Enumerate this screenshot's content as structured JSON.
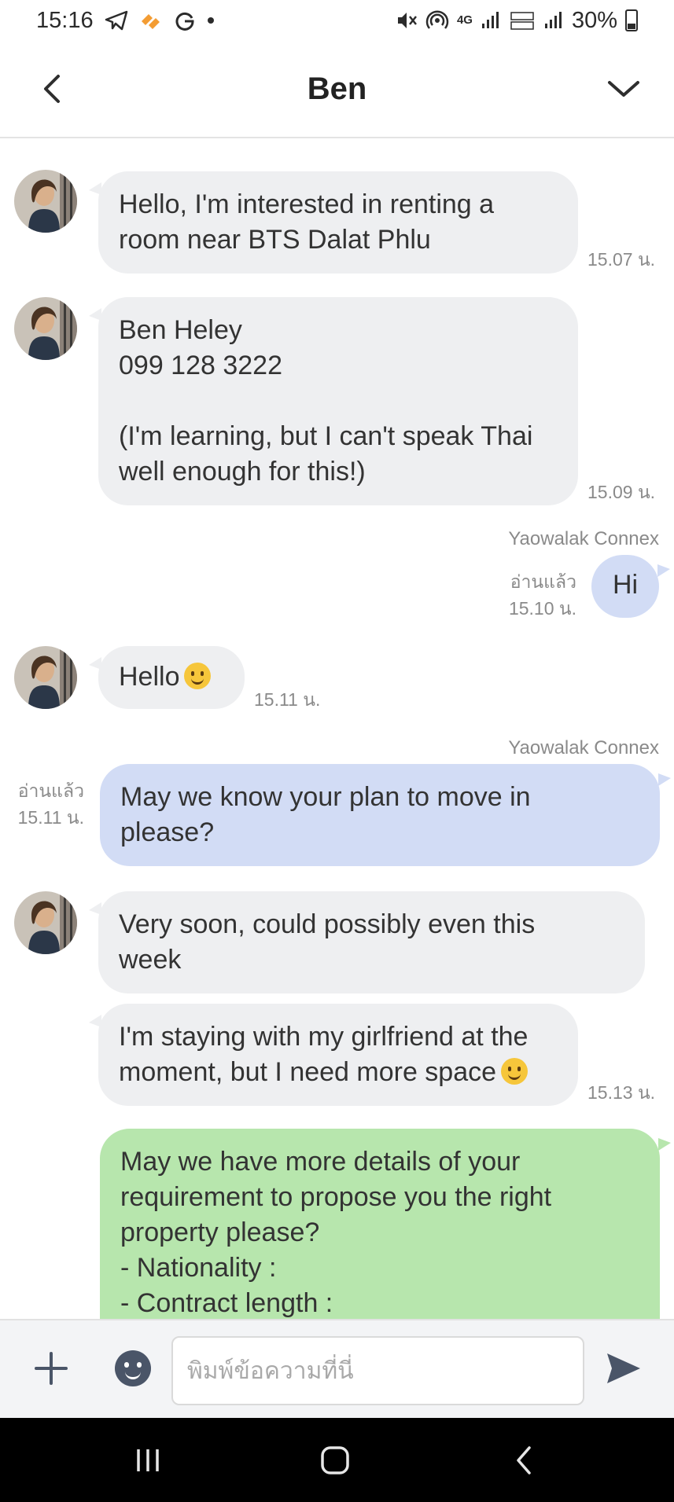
{
  "status_bar": {
    "time": "15:16",
    "battery": "30%",
    "network": "4G"
  },
  "header": {
    "title": "Ben"
  },
  "messages": {
    "m1": {
      "lines": [
        "Hello, I'm interested in renting a",
        "room near BTS Dalat Phlu"
      ],
      "time": "15.07 น."
    },
    "m2": {
      "lines": [
        "Ben Heley",
        "099 128 3222",
        "",
        "(I'm learning, but I can't speak Thai",
        "well enough for this!)"
      ],
      "time": "15.09 น."
    },
    "m3": {
      "sender": "Yaowalak Connex",
      "text": "Hi",
      "read": "อ่านแล้ว",
      "time": "15.10 น."
    },
    "m4": {
      "text": "Hello",
      "time": "15.11 น."
    },
    "m5": {
      "sender": "Yaowalak Connex",
      "lines": [
        "May we know your plan to move in",
        "please?"
      ],
      "read": "อ่านแล้ว",
      "time": "15.11 น."
    },
    "m6": {
      "lines": [
        "Very soon, could possibly even this",
        "week"
      ]
    },
    "m7": {
      "lines": [
        "I'm staying with my girlfriend at the",
        "moment, but I need more space"
      ],
      "time": "15.13 น."
    },
    "m8": {
      "lines": [
        "May we have more details of your",
        "requirement to propose you the right",
        "property please?",
        "- Nationality :",
        "- Contract length :"
      ]
    }
  },
  "input_bar": {
    "placeholder": "พิมพ์ข้อความที่นี่"
  },
  "colors": {
    "incoming_bubble": "#eeeff1",
    "outgoing_bubble": "#d2dcf5",
    "template_bubble": "#b7e6ad",
    "icon": "#4a5568"
  }
}
